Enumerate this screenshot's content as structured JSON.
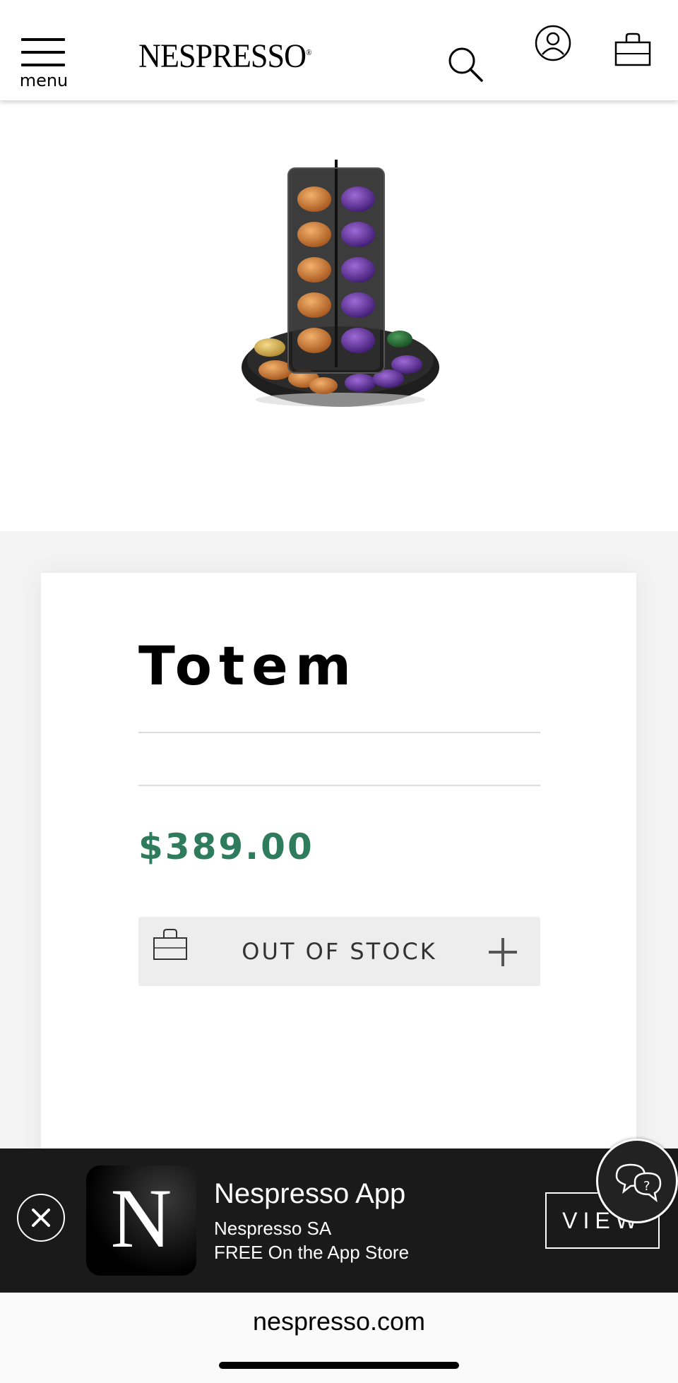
{
  "header": {
    "menu_label": "menu",
    "logo_text": "NESPRESSO",
    "logo_mark": "®",
    "icons": [
      "hamburger-menu-icon",
      "search-icon",
      "account-icon",
      "shopping-bag-icon"
    ]
  },
  "product": {
    "title": "Totem",
    "price": "$389.00",
    "price_color": "#2f7b5d",
    "stock_label": "OUT OF STOCK",
    "image": "capsule-dispenser-tower"
  },
  "app_banner": {
    "app_name": "Nespresso App",
    "company": "Nespresso SA",
    "price_note": "FREE On the App Store",
    "action_label": "VIEW",
    "tile_letter": "N"
  },
  "browser": {
    "url": "nespresso.com"
  }
}
